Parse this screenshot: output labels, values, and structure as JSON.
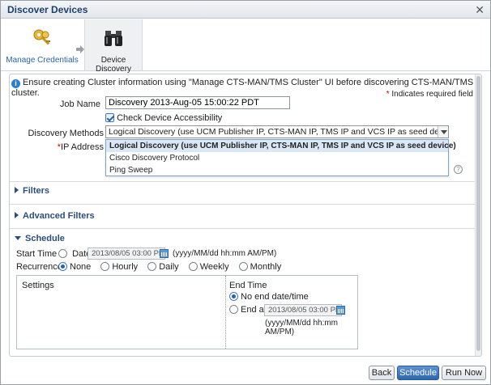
{
  "dialog": {
    "title": "Discover Devices",
    "close_glyph": "✕"
  },
  "wizard": {
    "steps": [
      {
        "label": "Manage Credentials",
        "icon": "keys-icon"
      },
      {
        "label": "Device Discovery",
        "icon": "binoculars-icon"
      }
    ]
  },
  "info": {
    "message": "Ensure creating Cluster information using \"Manage CTS-MAN/TMS Cluster\" UI before discovering CTS-MAN/TMS cluster.",
    "required_star": "*",
    "required_note": "Indicates required field"
  },
  "form": {
    "job_name_label": "Job Name",
    "job_name_value": "Discovery 2013-Aug-05 15:00:22 PDT",
    "check_access_label": "Check Device Accessibility",
    "check_access_checked": true,
    "discovery_methods_label": "Discovery Methods",
    "discovery_methods_selected": "Logical Discovery (use UCM Publisher IP, CTS-MAN IP, TMS IP and VCS IP as seed device)",
    "discovery_methods_options": [
      "Logical Discovery (use UCM Publisher IP, CTS-MAN IP, TMS IP and VCS IP as seed device)",
      "Cisco Discovery Protocol",
      "Ping Sweep"
    ],
    "ip_address_star": "*",
    "ip_address_label": "IP Address",
    "help_glyph": "?"
  },
  "sections": {
    "filters": "Filters",
    "advanced_filters": "Advanced Filters",
    "schedule": "Schedule"
  },
  "schedule": {
    "start_time_label": "Start Time",
    "date_label": "Date:",
    "date_value": "2013/08/05 03:00 PM",
    "date_format": "(yyyy/MM/dd hh:mm AM/PM)",
    "recurrence_label": "Recurrence",
    "recurrence_options": [
      "None",
      "Hourly",
      "Daily",
      "Weekly",
      "Monthly"
    ],
    "recurrence_selected": "None",
    "settings_label": "Settings",
    "end_time_label": "End Time",
    "no_end_label": "No end date/time",
    "end_at_label": "End at",
    "end_at_value": "2013/08/05 03:00 PM",
    "end_format": "(yyyy/MM/dd hh:mm AM/PM)"
  },
  "footer": {
    "back_label": "Back",
    "schedule_label": "Schedule",
    "run_now_label": "Run Now"
  },
  "colors": {
    "title_text": "#1f3f6b",
    "link": "#2a64a8",
    "primary_button": "#2d67ad",
    "required": "#d10000"
  }
}
